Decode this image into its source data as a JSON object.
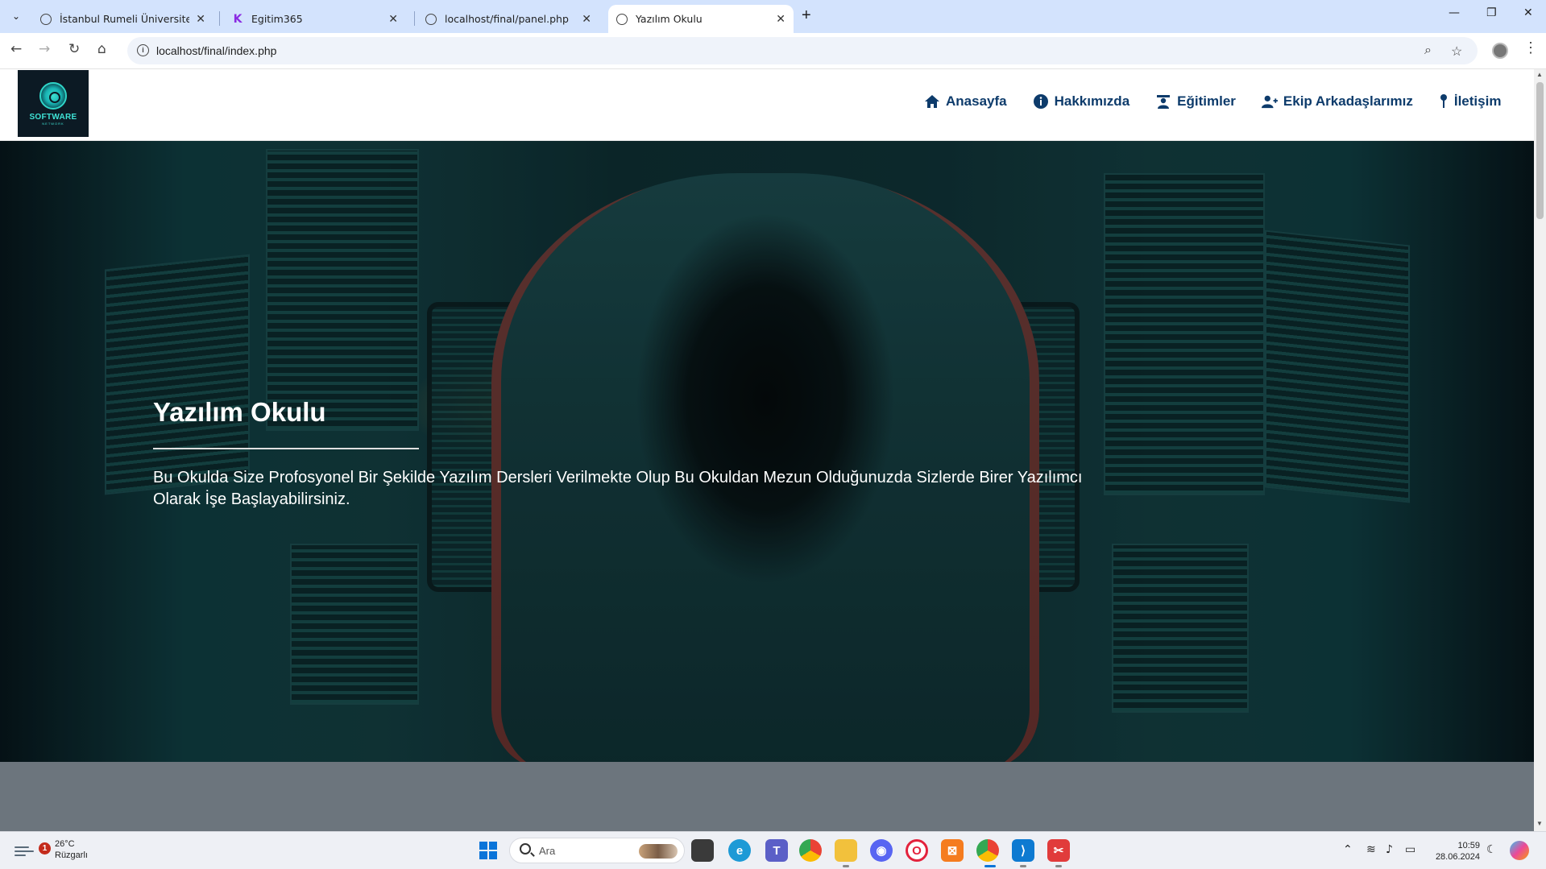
{
  "browser": {
    "tabs": [
      {
        "title": "İstanbul Rumeli Üniversitesi – U",
        "favicon": "globe-icon",
        "active": false
      },
      {
        "title": "Egitim365",
        "favicon": "k-logo-icon",
        "active": false
      },
      {
        "title": "localhost/final/panel.php",
        "favicon": "globe-icon",
        "active": false
      },
      {
        "title": "Yazılım Okulu",
        "favicon": "globe-icon",
        "active": true
      }
    ],
    "url": "localhost/final/index.php"
  },
  "site": {
    "logo": {
      "text": "SOFTWARE",
      "subtext": "NETWORK"
    },
    "nav": [
      {
        "label": "Anasayfa",
        "icon": "home-icon"
      },
      {
        "label": "Hakkımızda",
        "icon": "info-icon"
      },
      {
        "label": "Eğitimler",
        "icon": "teacher-icon"
      },
      {
        "label": "Ekip Arkadaşlarımız",
        "icon": "user-plus-icon"
      },
      {
        "label": "İletişim",
        "icon": "pin-icon"
      }
    ],
    "hero": {
      "title": "Yazılım Okulu",
      "text": "Bu Okulda Size Profosyonel Bir Şekilde Yazılım Dersleri Verilmekte Olup Bu Okuldan Mezun Olduğunuzda Sizlerde Birer Yazılımcı Olarak İşe Başlayabilirsiniz."
    }
  },
  "taskbar": {
    "weather": {
      "temp": "26°C",
      "desc": "Rüzgarlı",
      "badge": "1"
    },
    "search_placeholder": "Ara",
    "time": "10:59",
    "date": "28.06.2024"
  },
  "colors": {
    "nav_text": "#0d3b6b",
    "tabbar_bg": "#d3e3fd",
    "below_hero_bg": "#6c757d"
  }
}
